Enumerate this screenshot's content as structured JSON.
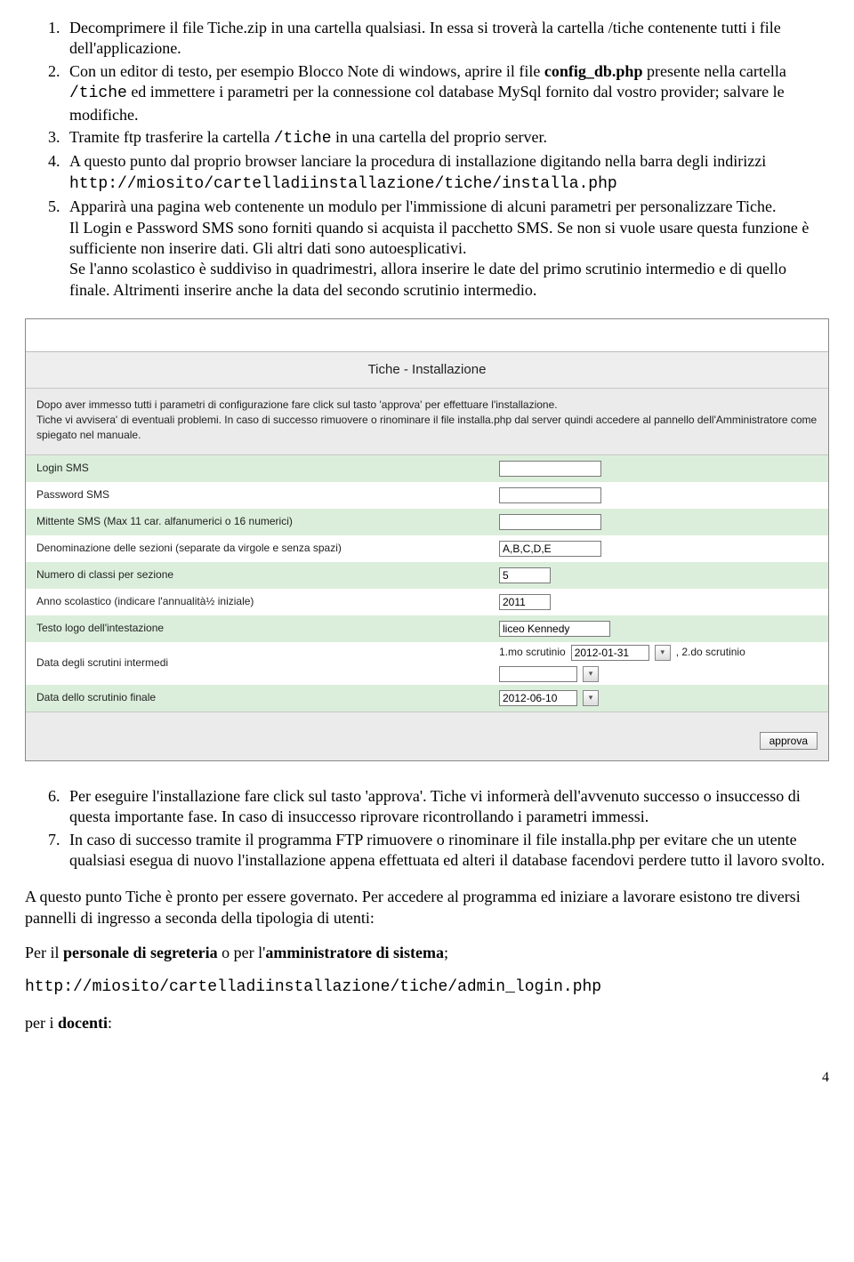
{
  "list1": {
    "i1a": "Decomprimere il file Tiche.zip in una cartella qualsiasi. In essa si troverà la cartella /tiche contenente tutti i file dell'applicazione.",
    "i2a": "Con un editor di testo, per esempio Blocco Note di windows, aprire il file ",
    "i2b": "config_db.php",
    "i2c": " presente nella cartella ",
    "i2d": "/tiche",
    "i2e": " ed immettere i parametri per la connessione col database MySql fornito dal vostro provider; salvare le modifiche.",
    "i3a": "Tramite ftp trasferire la cartella ",
    "i3b": "/tiche",
    "i3c": " in una cartella del proprio server.",
    "i4a": "A questo punto dal proprio browser lanciare la procedura di installazione digitando nella barra degli indirizzi",
    "i4url": "http://miosito/cartelladiinstallazione/tiche/installa.php",
    "i5a": "Apparirà una pagina web contenente un modulo per l'immissione di alcuni parametri per personalizzare Tiche.",
    "i5b": "Il Login e Password SMS sono forniti quando si acquista il pacchetto SMS. Se non si vuole usare questa funzione è sufficiente non inserire dati. Gli altri dati sono autoesplicativi.",
    "i5c": "Se l'anno scolastico è suddiviso in quadrimestri, allora inserire le date del primo scrutinio intermedio e di quello finale. Altrimenti inserire anche la data del secondo scrutinio intermedio."
  },
  "panel": {
    "title": "Tiche - Installazione",
    "desc1": "Dopo aver immesso tutti i parametri di configurazione fare click sul tasto 'approva' per effettuare l'installazione.",
    "desc2": "Tiche vi avvisera' di eventuali problemi. In caso di successo rimuovere o rinominare il file installa.php dal server quindi accedere al pannello dell'Amministratore come spiegato nel manuale.",
    "rows": {
      "login_sms": "Login SMS",
      "password_sms": "Password SMS",
      "mittente_sms": "Mittente SMS (Max 11 car. alfanumerici o 16 numerici)",
      "denom_sezioni": "Denominazione delle sezioni (separate da virgole e senza spazi)",
      "num_classi": "Numero di classi per sezione",
      "anno": "Anno scolastico (indicare l'annualità½ iniziale)",
      "testo_logo": "Testo logo dell'intestazione",
      "scrutini_interm": "Data degli scrutini intermedi",
      "scrutinio_finale": "Data dello scrutinio finale"
    },
    "values": {
      "sezioni": "A,B,C,D,E",
      "num_classi": "5",
      "anno": "2011",
      "logo": "liceo Kennedy",
      "scr_label1": "1.mo scrutinio",
      "scr_date1": "2012-01-31",
      "scr_label2": ", 2.do scrutinio",
      "scr_finale": "2012-06-10"
    },
    "approve": "approva"
  },
  "list2": {
    "i6": "Per eseguire l'installazione fare click sul tasto 'approva'. Tiche vi informerà dell'avvenuto successo o insuccesso di questa importante fase. In caso di insuccesso riprovare ricontrollando i parametri immessi.",
    "i7": "In caso di successo tramite il programma FTP rimuovere o rinominare il file installa.php per evitare che un utente qualsiasi esegua di nuovo l'installazione appena effettuata ed alteri il database facendovi perdere tutto il lavoro svolto."
  },
  "para1a": "A questo punto Tiche è pronto per essere governato. Per accedere al programma ed iniziare a lavorare esistono tre diversi pannelli di ingresso a seconda della tipologia di utenti:",
  "para2a": "Per il ",
  "para2b": "personale di segreteria",
  "para2c": " o per l'",
  "para2d": "amministratore di sistema",
  "para2e": ";",
  "url_admin": "http://miosito/cartelladiinstallazione/tiche/admin_login.php",
  "para3a": "per i ",
  "para3b": "docenti",
  "para3c": ":",
  "page_number": "4"
}
